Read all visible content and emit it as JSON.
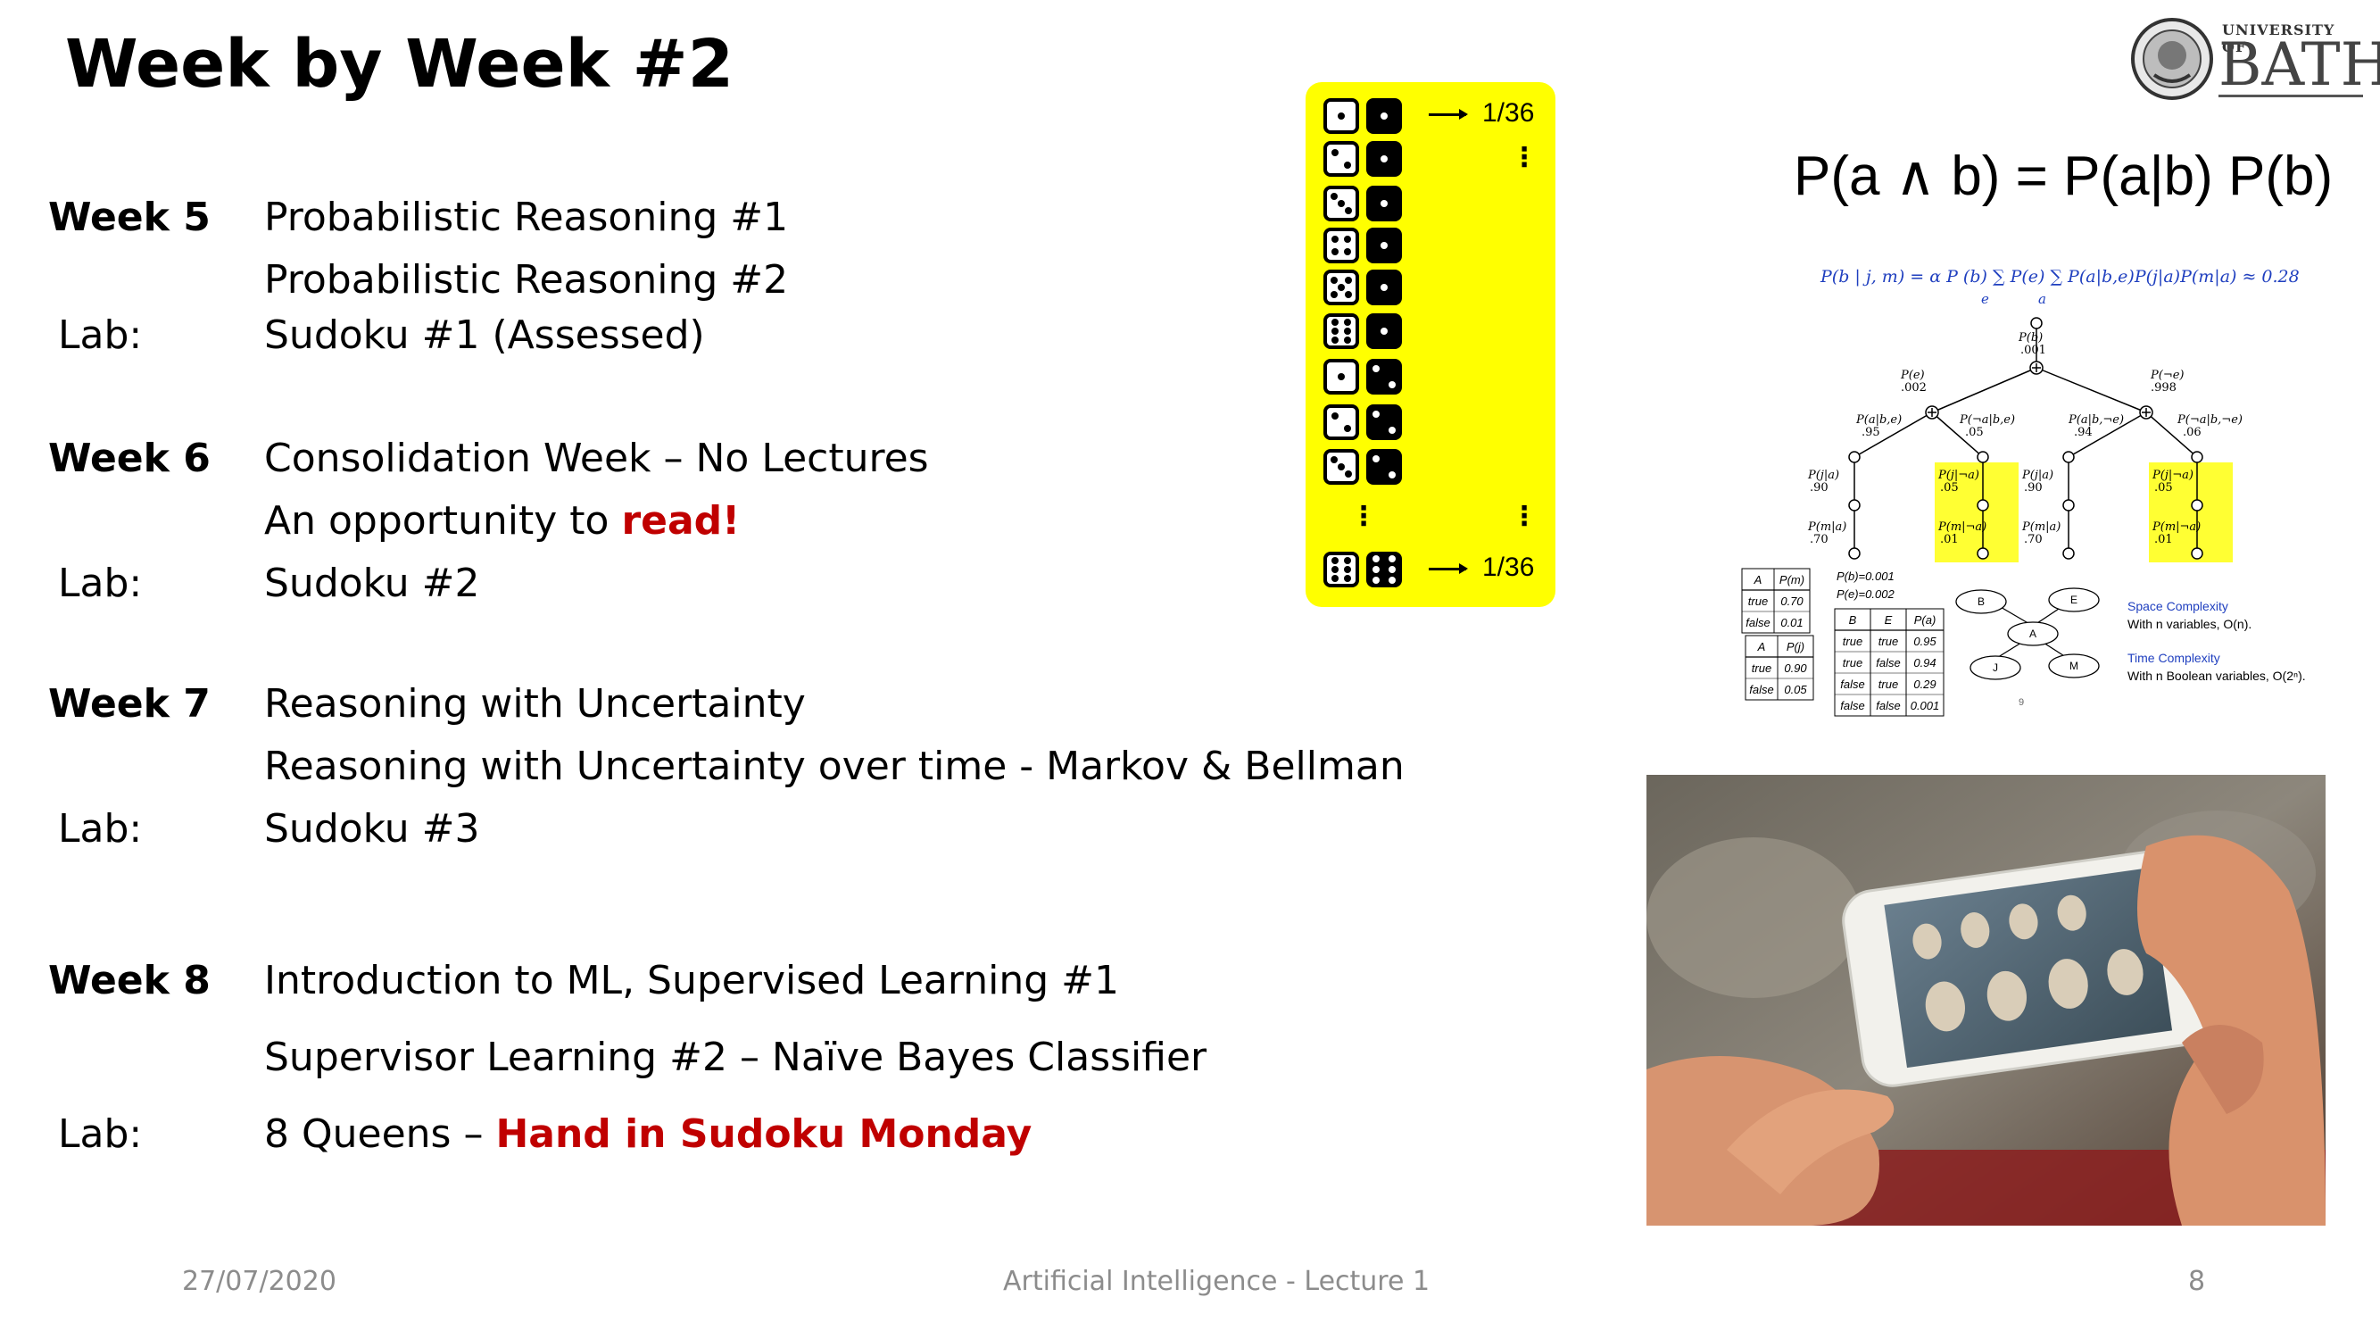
{
  "title": "Week by Week #2",
  "schedule": [
    {
      "label": "Week 5",
      "kind": "week",
      "top": 0,
      "text": [
        {
          "t": "Probabilistic Reasoning #1"
        }
      ]
    },
    {
      "label": "",
      "kind": "",
      "text": [
        {
          "t": "Probabilistic Reasoning #2"
        }
      ]
    },
    {
      "label": "Lab:",
      "kind": "lab",
      "text": [
        {
          "t": "Sudoku #1 (Assessed)"
        }
      ]
    },
    {
      "label": "Week 6",
      "kind": "week",
      "text": [
        {
          "t": "Consolidation Week – No Lectures"
        }
      ]
    },
    {
      "label": "",
      "kind": "",
      "text": [
        {
          "t": "An opportunity to "
        },
        {
          "t": "read!",
          "red": true
        }
      ]
    },
    {
      "label": "Lab:",
      "kind": "lab",
      "text": [
        {
          "t": "Sudoku #2"
        }
      ]
    },
    {
      "label": "Week 7",
      "kind": "week",
      "text": [
        {
          "t": "Reasoning with Uncertainty"
        }
      ]
    },
    {
      "label": "",
      "kind": "",
      "text": [
        {
          "t": "Reasoning with Uncertainty over time - Markov & Bellman"
        }
      ]
    },
    {
      "label": "Lab:",
      "kind": "lab",
      "text": [
        {
          "t": "Sudoku #3"
        }
      ]
    },
    {
      "label": "Week 8",
      "kind": "week",
      "text": [
        {
          "t": "Introduction to ML, Supervised Learning #1"
        }
      ]
    },
    {
      "label": "",
      "kind": "",
      "text": [
        {
          "t": "Supervisor Learning #2 – Naïve Bayes Classifier"
        }
      ]
    },
    {
      "label": "Lab:",
      "kind": "lab",
      "text": [
        {
          "t": "8 Queens – "
        },
        {
          "t": "Hand in Sudoku Monday",
          "red": true
        }
      ]
    }
  ],
  "logo": {
    "university": "UNIVERSITY OF",
    "name": "BATH"
  },
  "dice": {
    "pairs": [
      [
        1,
        1
      ],
      [
        2,
        1
      ],
      [
        3,
        1
      ],
      [
        4,
        1
      ],
      [
        5,
        1
      ],
      [
        6,
        1
      ],
      [
        1,
        2
      ],
      [
        2,
        2
      ],
      [
        3,
        2
      ]
    ],
    "last_pair": [
      6,
      6
    ],
    "first_prob": "1/36",
    "last_prob": "1/36"
  },
  "formula": "P(a ∧ b) = P(a|b) P(b)",
  "bayes_net": {
    "equation": "P(b | j, m) = α P (b) ∑ P(e) ∑ P(a|b,e)P(j|a)P(m|a) ≈ 0.28",
    "sum_e": "e",
    "sum_a": "a",
    "root": "P(b)",
    "root_val": ".001",
    "pe": "P(e)",
    "pe_val": ".002",
    "pne": "P(¬e)",
    "pne_val": ".998",
    "a1": "P(a|b,e)",
    "a1_val": ".95",
    "a2": "P(¬a|b,e)",
    "a2_val": ".05",
    "a3": "P(a|b,¬e)",
    "a3_val": ".94",
    "a4": "P(¬a|b,¬e)",
    "a4_val": ".06",
    "pja": "P(j|a)",
    "pja_val": ".90",
    "pjna": "P(j|¬a)",
    "pjna_val": ".05",
    "pma": "P(m|a)",
    "pma_val": ".70",
    "pmna": "P(m|¬a)",
    "pmna_val": ".01",
    "pb_line": "P(b)=0.001",
    "pe_line": "P(e)=0.002",
    "table_m": {
      "head": [
        "A",
        "P(m)"
      ],
      "rows": [
        [
          "true",
          "0.70"
        ],
        [
          "false",
          "0.01"
        ]
      ]
    },
    "table_j": {
      "head": [
        "A",
        "P(j)"
      ],
      "rows": [
        [
          "true",
          "0.90"
        ],
        [
          "false",
          "0.05"
        ]
      ]
    },
    "table_a": {
      "head": [
        "B",
        "E",
        "P(a)"
      ],
      "rows": [
        [
          "true",
          "true",
          "0.95"
        ],
        [
          "true",
          "false",
          "0.94"
        ],
        [
          "false",
          "true",
          "0.29"
        ],
        [
          "false",
          "false",
          "0.001"
        ]
      ]
    },
    "nodes": [
      "B",
      "E",
      "A",
      "J",
      "M"
    ],
    "space_title": "Space Complexity",
    "space_text": "With n variables, O(n).",
    "time_title": "Time Complexity",
    "time_text": "With n Boolean variables, O(2ⁿ).",
    "page_num": "9"
  },
  "footer": {
    "date": "27/07/2020",
    "center": "Artificial Intelligence - Lecture 1",
    "page": "8"
  }
}
